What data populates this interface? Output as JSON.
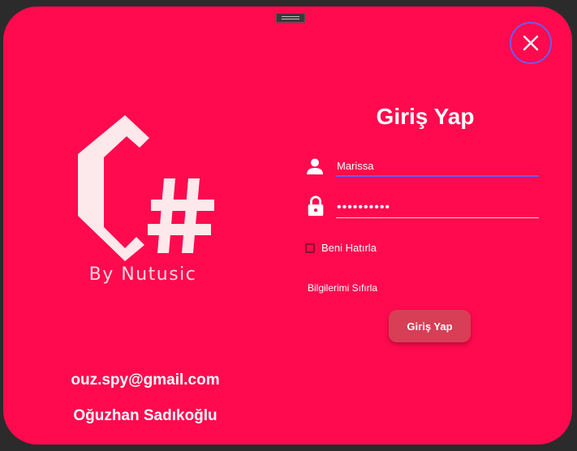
{
  "logo": {
    "glyph_c": "C",
    "glyph_hash": "#",
    "caption": "By Nutusic"
  },
  "contact": {
    "email": "ouz.spy@gmail.com",
    "name": "Oğuzhan Sadıkoğlu"
  },
  "form": {
    "title": "Giriş Yap",
    "username_value": "Marissa",
    "password_value": "••••••••••",
    "remember_label": "Beni Hatırla",
    "remember_checked": false,
    "reset_label": "Bilgilerimi Sıfırla",
    "submit_label": "Giriş Yap"
  },
  "icons": {
    "close": "close-icon",
    "user": "user-icon",
    "lock": "lock-icon",
    "drag": "drag-handle-icon"
  },
  "colors": {
    "background": "#ff0a4e",
    "accent": "#6a5cf0",
    "button": "#d83e55",
    "text": "#ffffff"
  }
}
